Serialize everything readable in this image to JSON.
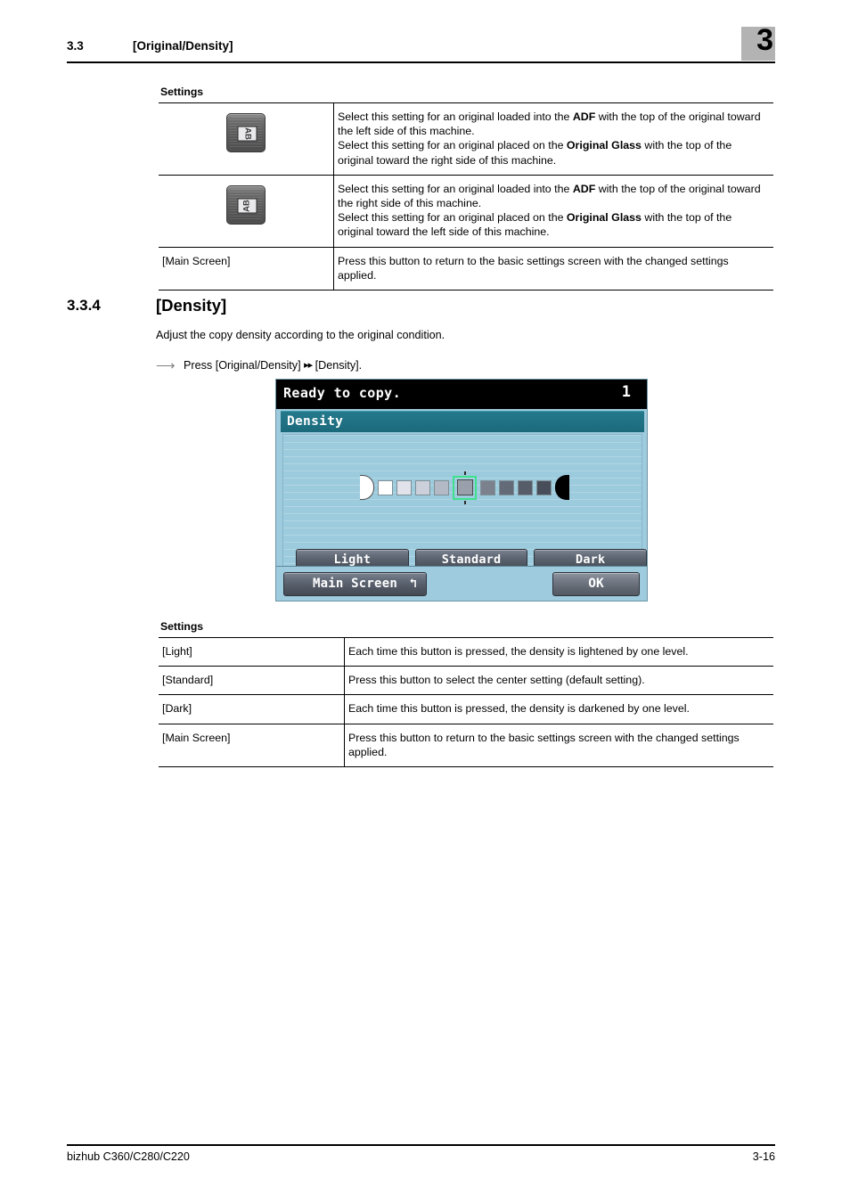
{
  "header": {
    "section_number": "3.3",
    "section_title": "[Original/Density]",
    "chapter_number": "3"
  },
  "table_top": {
    "caption": "Settings",
    "rows": [
      {
        "label_type": "icon",
        "icon_name": "original-orientation-top-left-icon",
        "icon_text": "AB",
        "description_lines": [
          "Select this setting for an original loaded into the ADF with the top of the",
          "original toward the left side of this machine.",
          "Select this setting for an original placed on the Original Glass with the top",
          "of the original toward the right side of this machine."
        ]
      },
      {
        "label_type": "icon",
        "icon_name": "original-orientation-top-right-icon",
        "icon_text": "AB",
        "description_lines": [
          "Select this setting for an original loaded into the ADF with the top of the",
          "original toward the right side of this machine.",
          "Select this setting for an original placed on the Original Glass with the top",
          "of the original toward the left side of this machine."
        ]
      },
      {
        "label_type": "text",
        "label": "[Main Screen]",
        "description_lines": [
          "Press this button to return to the basic settings screen with the changed",
          "settings applied."
        ]
      }
    ]
  },
  "section": {
    "number": "3.3.4",
    "title": "[Density]",
    "intro": "Adjust the copy density according to the original condition.",
    "step_prefix": "Press [Original/Density]",
    "step_arrow": "▸▸",
    "step_suffix": "[Density]."
  },
  "lcd": {
    "status_text": "Ready to copy.",
    "copy_count": "1",
    "panel_title": "Density",
    "density": {
      "selected_index": 4,
      "levels": 9,
      "swatch_colors": [
        "#ffffff",
        "#e2e3ea",
        "#ccd0da",
        "#b4bac5",
        "#9aa0ab",
        "#7b828e",
        "#646b78",
        "#565d69",
        "#474e5a"
      ],
      "cap_light_color": "#ffffff",
      "cap_dark_color": "#000000",
      "selection_color": "#3fe08d"
    },
    "buttons": [
      {
        "name": "light",
        "label": "Light"
      },
      {
        "name": "standard",
        "label": "Standard"
      },
      {
        "name": "dark",
        "label": "Dark"
      }
    ],
    "footer": {
      "main_screen_label": "Main Screen",
      "main_screen_icon": "↰",
      "ok_label": "OK"
    },
    "colors": {
      "panel_background": "#9ecbdd",
      "title_bar": "#1b6a7c",
      "status_bar": "#000000"
    }
  },
  "table_bottom": {
    "caption": "Settings",
    "rows": [
      {
        "label": "[Light]",
        "description_lines": [
          "Each time this button is pressed, the density is lightened by one level."
        ]
      },
      {
        "label": "[Standard]",
        "description_lines": [
          "Press this button to select the center setting (default setting)."
        ]
      },
      {
        "label": "[Dark]",
        "description_lines": [
          "Each time this button is pressed, the density is darkened by one level."
        ]
      },
      {
        "label": "[Main Screen]",
        "description_lines": [
          "Press this button to return to the basic settings screen with the changed",
          "settings applied."
        ]
      }
    ]
  },
  "footer": {
    "product": "bizhub C360/C280/C220",
    "page_number": "3-16"
  }
}
